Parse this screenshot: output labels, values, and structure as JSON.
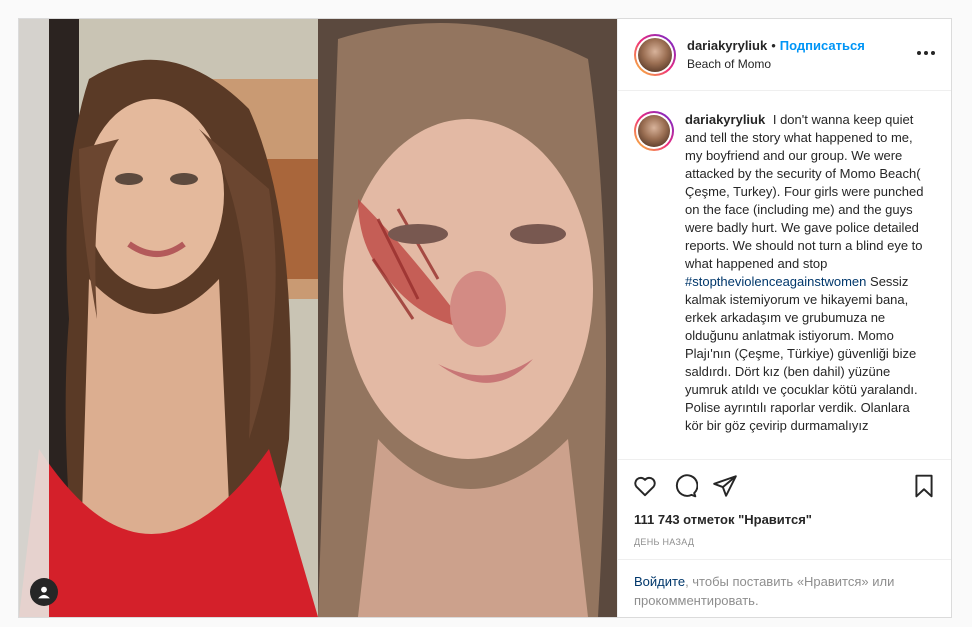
{
  "post": {
    "username": "dariakyryliuk",
    "dot": "•",
    "follow_label": "Подписаться",
    "location": "Beach of Momo",
    "caption_text": "I don't wanna keep quiet and tell the story what happened to me, my boyfriend and our group. We were attacked by the security of Momo Beach( Çeşme, Turkey). Four girls were punched on the face (including me) and the guys were badly hurt. We gave police detailed reports. We should not turn a blind eye to what happened and stop",
    "hashtag": "#stoptheviolenceagainstwomen",
    "caption_text_tr": "Sessiz kalmak istemiyorum ve hikayemi bana, erkek arkadaşım ve grubumuza ne olduğunu anlatmak istiyorum. Momo Plajı'nın (Çeşme, Türkiye) güvenliği bize saldırdı. Dört kız (ben dahil) yüzüne yumruk atıldı ve çocuklar kötü yaralandı. Polise ayrıntılı raporlar verdik. Olanlara kör bir göz çevirip durmamalıyız",
    "likes": "111 743 отметок \"Нравится\"",
    "time": "День назад",
    "login_link": "Войдите",
    "login_text": ", чтобы поставить «Нравится» или прокомментировать."
  },
  "icons": {
    "like": "heart-icon",
    "comment": "comment-icon",
    "share": "paper-plane-icon",
    "save": "bookmark-icon",
    "tagged": "user-icon",
    "more": "more-dots-icon"
  },
  "colors": {
    "link": "#0095f6",
    "hashtag": "#00376b",
    "muted": "#8e8e8e",
    "border": "#dbdbdb"
  }
}
